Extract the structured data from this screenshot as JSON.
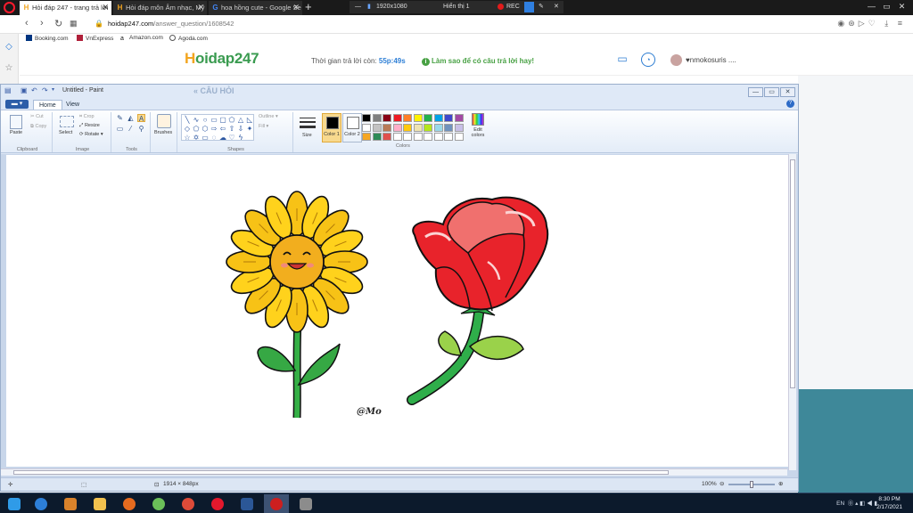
{
  "browser": {
    "tabs": [
      {
        "label": "Hỏi đáp 247 - trang trả lời",
        "active": true
      },
      {
        "label": "Hỏi đáp môn Âm nhạc, Mỹ",
        "active": false
      },
      {
        "label": "hoa hồng cute - Google Se",
        "active": false
      }
    ],
    "new_tab": "+",
    "recorder": {
      "resolution": "1920x1080",
      "label": "Hiển thị 1",
      "rec": "REC"
    },
    "window_buttons": [
      "—",
      "▭",
      "✕"
    ],
    "url": {
      "host": "hoidap247.com",
      "path": "/answer_question/1608542"
    },
    "bookmarks": [
      "Booking.com",
      "VnExpress",
      "Amazon.com",
      "Agoda.com"
    ]
  },
  "site": {
    "logo_first": "H",
    "logo_rest": "oidap247",
    "timer_label": "Thời gian trả lời còn:",
    "timer_value": "55p:49s",
    "hint_icon": "i",
    "hint": "Làm sao để có câu trả lời hay!",
    "username": "♥nmokosuris ....",
    "ghost_heading": "« CÂU HỎI"
  },
  "paint": {
    "title": "Untitled - Paint",
    "window_buttons": [
      "—",
      "▭",
      "✕"
    ],
    "tabs": [
      "Home",
      "View"
    ],
    "help": "?",
    "clipboard": {
      "paste": "Paste",
      "cut": "Cut",
      "copy": "Copy",
      "label": "Clipboard"
    },
    "image": {
      "select": "Select",
      "crop": "Crop",
      "resize": "Resize",
      "rotate": "Rotate ▾",
      "label": "Image"
    },
    "tools_label": "Tools",
    "brushes": "Brushes",
    "shapes": {
      "outline": "Outline ▾",
      "fill": "Fill ▾",
      "label": "Shapes"
    },
    "size": "Size",
    "color1": "Color 1",
    "color2": "Color 2",
    "colors_label": "Colors",
    "edit_colors": "Edit colors",
    "palette": [
      "#000000",
      "#7f7f7f",
      "#880015",
      "#ed1c24",
      "#ff7f27",
      "#fff200",
      "#22b14c",
      "#00a2e8",
      "#3f48cc",
      "#a349a4",
      "#ffffff",
      "#c3c3c3",
      "#b97a57",
      "#ffaec9",
      "#ffc90e",
      "#efe4b0",
      "#b5e61d",
      "#99d9ea",
      "#7092be",
      "#c8bfe7",
      "#f5a623",
      "#2e8b57",
      "#e0504d",
      "#ffffff",
      "#ffffff",
      "#ffffff",
      "#ffffff",
      "#ffffff",
      "#ffffff",
      "#ffffff"
    ],
    "primary_color": "#000000",
    "secondary_color": "#ffffff",
    "signature": "@Mo",
    "status": {
      "size": "1914 × 848px",
      "zoom": "100%",
      "zoom_minus": "⊖",
      "zoom_plus": "⊕"
    }
  },
  "taskbar": {
    "apps": [
      {
        "name": "windows-start",
        "color": "#2f9be8"
      },
      {
        "name": "edge",
        "color": "#2d7fd8"
      },
      {
        "name": "media",
        "color": "#d9822b"
      },
      {
        "name": "explorer",
        "color": "#f2c14e"
      },
      {
        "name": "firefox",
        "color": "#e66b1f"
      },
      {
        "name": "app-green",
        "color": "#6bbf59"
      },
      {
        "name": "chrome",
        "color": "#dd4b39"
      },
      {
        "name": "opera",
        "color": "#e3182d"
      },
      {
        "name": "word",
        "color": "#2b5797"
      },
      {
        "name": "recorder",
        "color": "#cc1f1f"
      },
      {
        "name": "app-gray",
        "color": "#8c8c8c"
      }
    ],
    "lang": "EN",
    "time": "8:30 PM",
    "date": "2/17/2021"
  }
}
